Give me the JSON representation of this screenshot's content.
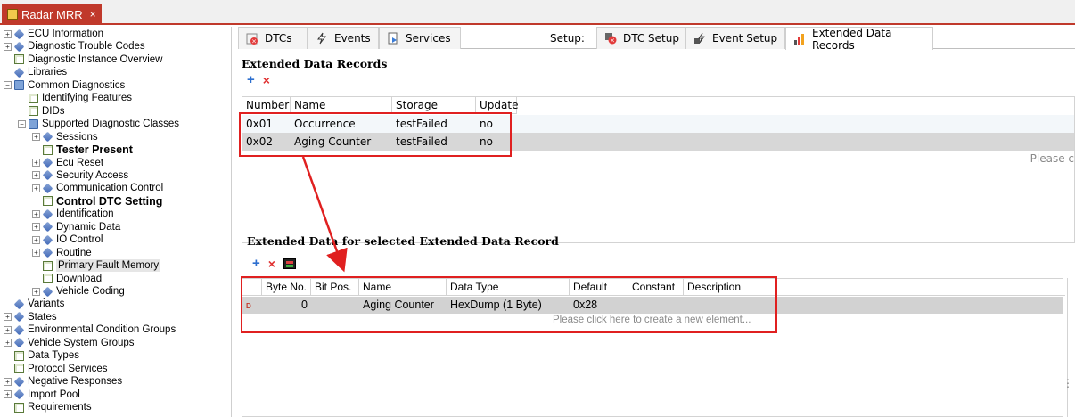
{
  "document_tab": {
    "title": "Radar MRR",
    "close": "×"
  },
  "tree": {
    "items": [
      {
        "label": "ECU Information",
        "level": 0,
        "expander": "+",
        "icon": "diamond"
      },
      {
        "label": "Diagnostic Trouble Codes",
        "level": 0,
        "expander": "+",
        "icon": "diamond"
      },
      {
        "label": "Diagnostic Instance Overview",
        "level": 0,
        "expander": "",
        "icon": "page"
      },
      {
        "label": "Libraries",
        "level": 0,
        "expander": "",
        "icon": "diamond"
      },
      {
        "label": "Common Diagnostics",
        "level": 0,
        "expander": "−",
        "icon": "folder"
      },
      {
        "label": "Identifying Features",
        "level": 1,
        "expander": "",
        "icon": "page"
      },
      {
        "label": "DIDs",
        "level": 1,
        "expander": "",
        "icon": "page"
      },
      {
        "label": "Supported Diagnostic Classes",
        "level": 1,
        "expander": "−",
        "icon": "folder"
      },
      {
        "label": "Sessions",
        "level": 2,
        "expander": "+",
        "icon": "diamond"
      },
      {
        "label": "Tester Present",
        "level": 2,
        "expander": "",
        "icon": "page",
        "bold": true
      },
      {
        "label": "Ecu Reset",
        "level": 2,
        "expander": "+",
        "icon": "diamond"
      },
      {
        "label": "Security Access",
        "level": 2,
        "expander": "+",
        "icon": "diamond"
      },
      {
        "label": "Communication Control",
        "level": 2,
        "expander": "+",
        "icon": "diamond"
      },
      {
        "label": "Control DTC Setting",
        "level": 2,
        "expander": "",
        "icon": "page",
        "bold": true
      },
      {
        "label": "Identification",
        "level": 2,
        "expander": "+",
        "icon": "diamond"
      },
      {
        "label": "Dynamic Data",
        "level": 2,
        "expander": "+",
        "icon": "diamond"
      },
      {
        "label": "IO Control",
        "level": 2,
        "expander": "+",
        "icon": "diamond"
      },
      {
        "label": "Routine",
        "level": 2,
        "expander": "+",
        "icon": "diamond"
      },
      {
        "label": "Primary Fault Memory",
        "level": 2,
        "expander": "",
        "icon": "page",
        "selected": true
      },
      {
        "label": "Download",
        "level": 2,
        "expander": "",
        "icon": "page"
      },
      {
        "label": "Vehicle Coding",
        "level": 2,
        "expander": "+",
        "icon": "diamond"
      },
      {
        "label": "Variants",
        "level": 0,
        "expander": "",
        "icon": "diamond"
      },
      {
        "label": "States",
        "level": 0,
        "expander": "+",
        "icon": "diamond"
      },
      {
        "label": "Environmental Condition Groups",
        "level": 0,
        "expander": "+",
        "icon": "diamond"
      },
      {
        "label": "Vehicle System Groups",
        "level": 0,
        "expander": "+",
        "icon": "diamond"
      },
      {
        "label": "Data Types",
        "level": 0,
        "expander": "",
        "icon": "page"
      },
      {
        "label": "Protocol Services",
        "level": 0,
        "expander": "",
        "icon": "page"
      },
      {
        "label": "Negative Responses",
        "level": 0,
        "expander": "+",
        "icon": "diamond"
      },
      {
        "label": "Import Pool",
        "level": 0,
        "expander": "+",
        "icon": "diamond"
      },
      {
        "label": "Requirements",
        "level": 0,
        "expander": "",
        "icon": "page"
      }
    ]
  },
  "tabs": {
    "dtcs": "DTCs",
    "events": "Events",
    "services": "Services",
    "setup_label": "Setup:",
    "dtc_setup": "DTC Setup",
    "event_setup": "Event Setup",
    "extended_data_records": "Extended Data Records"
  },
  "records_section": {
    "title": "Extended Data Records",
    "add": "+",
    "delete": "×",
    "columns": [
      "Number",
      "Name",
      "Storage Trigger",
      "Update"
    ],
    "rows": [
      [
        "0x01",
        "Occurrence Counter",
        "testFailed",
        "no"
      ],
      [
        "0x02",
        "Aging Counter",
        "testFailed",
        "no"
      ]
    ],
    "hint": "Please c"
  },
  "data_section": {
    "title": "Extended Data for selected Extended Data Record",
    "add": "+",
    "delete": "×",
    "columns": [
      "Byte No.",
      "Bit Pos.",
      "Name",
      "Data Type",
      "Default",
      "Constant",
      "Description"
    ],
    "row": {
      "marker": "D",
      "byte_no": "0",
      "bit_pos": "",
      "name": "Aging Counter",
      "data_type": "HexDump (1 Byte)",
      "default": "0x28",
      "constant": "",
      "description": ""
    },
    "hint": "Please click here to create a new element...",
    "grip": "⋮"
  },
  "colors": {
    "accent": "#c0392b",
    "highlight": "#e02020",
    "selected_row": "#d7d7d7"
  }
}
